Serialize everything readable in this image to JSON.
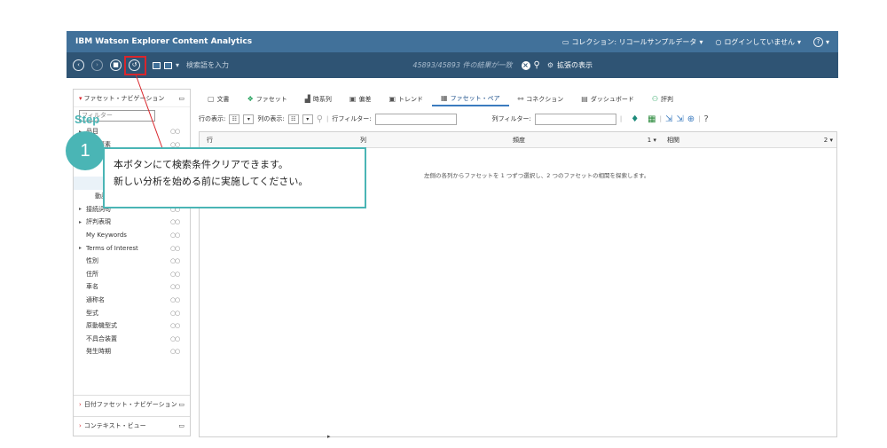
{
  "header": {
    "app_title": "IBM Watson Explorer Content Analytics",
    "collection": "コレクション: リコールサンプルデータ",
    "login": "ログインしていません",
    "help": "?"
  },
  "toolbar": {
    "search_placeholder": "検索語を入力",
    "result_count": "45893/45893 件の結果が一致",
    "expand_label": "拡張の表示"
  },
  "tutorial": {
    "step_label": "Step",
    "step_number": "1",
    "callout_line1": "本ボタンにて検索条件クリアできます。",
    "callout_line2": "新しい分析を始める前に実施してください。",
    "accent_color": "#4ab5b5",
    "highlight_color": "#d9262c"
  },
  "sidebar": {
    "title": "ファセット・ナビゲーション",
    "filter_placeholder": "フィルター",
    "items": [
      {
        "label": "品目",
        "expandable": true,
        "indent": false
      },
      {
        "label": "構成要素",
        "expandable": true,
        "indent": false
      },
      {
        "label": "",
        "expandable": false,
        "indent": false
      },
      {
        "label": "",
        "expandable": false,
        "indent": false
      },
      {
        "label": "",
        "expandable": false,
        "indent": false,
        "selected": true
      },
      {
        "label": "動詞 - 名詞",
        "expandable": false,
        "indent": true
      },
      {
        "label": "接続詞句",
        "expandable": true,
        "indent": false
      },
      {
        "label": "評判表現",
        "expandable": true,
        "indent": false
      },
      {
        "label": "My Keywords",
        "expandable": false,
        "indent": false
      },
      {
        "label": "Terms of Interest",
        "expandable": true,
        "indent": false
      },
      {
        "label": "性別",
        "expandable": false,
        "indent": false
      },
      {
        "label": "住所",
        "expandable": false,
        "indent": false
      },
      {
        "label": "車名",
        "expandable": false,
        "indent": false
      },
      {
        "label": "通称名",
        "expandable": false,
        "indent": false
      },
      {
        "label": "型式",
        "expandable": false,
        "indent": false
      },
      {
        "label": "原動機型式",
        "expandable": false,
        "indent": false
      },
      {
        "label": "不具合装置",
        "expandable": false,
        "indent": false
      },
      {
        "label": "発生時期",
        "expandable": false,
        "indent": false
      }
    ],
    "date_facet_title": "日付ファセット・ナビゲーション",
    "context_view_title": "コンテキスト・ビュー"
  },
  "tabs": [
    {
      "label": "文書",
      "icon": "document-icon",
      "active": false
    },
    {
      "label": "ファセット",
      "icon": "facet-icon",
      "active": false
    },
    {
      "label": "時系列",
      "icon": "timeseries-icon",
      "active": false
    },
    {
      "label": "偏差",
      "icon": "deviation-icon",
      "active": false
    },
    {
      "label": "トレンド",
      "icon": "trend-icon",
      "active": false
    },
    {
      "label": "ファセット・ペア",
      "icon": "facet-pair-icon",
      "active": true
    },
    {
      "label": "コネクション",
      "icon": "connection-icon",
      "active": false
    },
    {
      "label": "ダッシュボード",
      "icon": "dashboard-icon",
      "active": false
    },
    {
      "label": "評判",
      "icon": "reputation-icon",
      "active": false
    }
  ],
  "controls": {
    "row_display_label": "行の表示:",
    "col_display_label": "列の表示:",
    "row_filter_label": "行フィルター:",
    "col_filter_label": "列フィルター:"
  },
  "table": {
    "columns": [
      {
        "label": "行",
        "sort": ""
      },
      {
        "label": "列",
        "sort": ""
      },
      {
        "label": "頻度",
        "sort": "1 ▾"
      },
      {
        "label": "相関",
        "sort": "2 ▾"
      }
    ],
    "empty_message": "左側の各列からファセットを 1 つずつ選択し、2 つのファセットの相関を探索します。"
  }
}
